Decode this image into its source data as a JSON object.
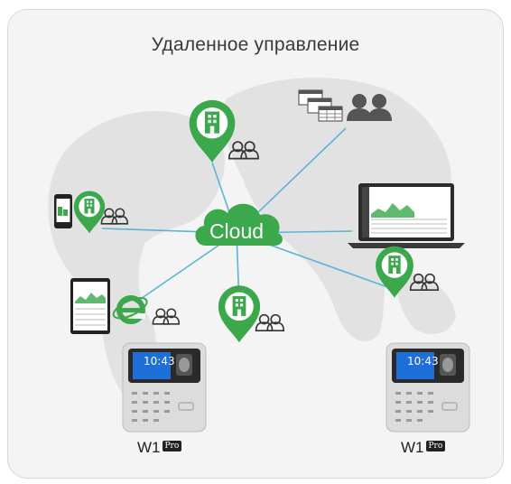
{
  "header": {
    "title": "Удаленное управление"
  },
  "cloud": {
    "label": "Cloud"
  },
  "devices": [
    {
      "model": "W1",
      "badge": "Pro",
      "time": "10:43"
    },
    {
      "model": "W1",
      "badge": "Pro",
      "time": "10:43"
    }
  ],
  "colors": {
    "pin_green": "#3aa84b",
    "link_blue": "#5ab4d6",
    "cloud_green": "#3aa84b",
    "map_gray": "#e3e3e3",
    "screen_blue": "#1e6fd8"
  },
  "icons": [
    "location-pin-icon",
    "building-icon",
    "users-icon",
    "cloud-icon",
    "spreadsheet-icon",
    "laptop-icon",
    "phone-icon",
    "tablet-icon",
    "internet-explorer-icon",
    "fingerprint-terminal-icon"
  ]
}
